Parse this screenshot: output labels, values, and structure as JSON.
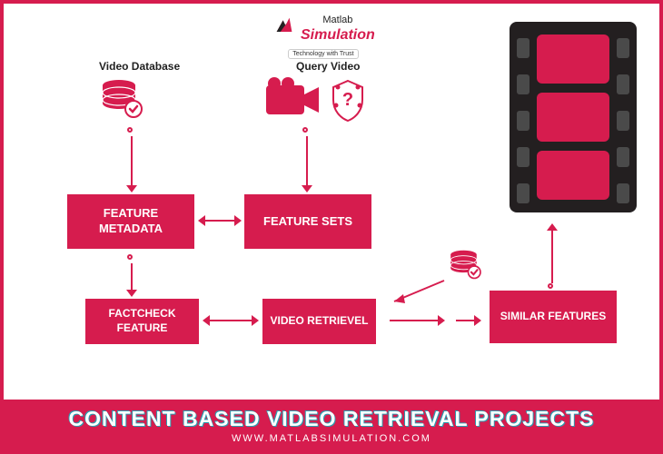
{
  "logo": {
    "brand_prefix": "Matlab",
    "brand": "Simulation",
    "tagline": "Technology with Trust"
  },
  "labels": {
    "database": "Video Database",
    "query": "Query Video"
  },
  "boxes": {
    "metadata": "FEATURE METADATA",
    "sets": "FEATURE SETS",
    "factcheck": "FACTCHECK FEATURE",
    "retrieval": "VIDEO RETRIEVEL",
    "similar": "SIMILAR FEATURES"
  },
  "title": {
    "main": "CONTENT BASED VIDEO RETRIEVAL PROJECTS",
    "url": "WWW.MATLABSIMULATION.COM"
  },
  "colors": {
    "primary": "#d61c4e",
    "dark": "#231f20"
  }
}
